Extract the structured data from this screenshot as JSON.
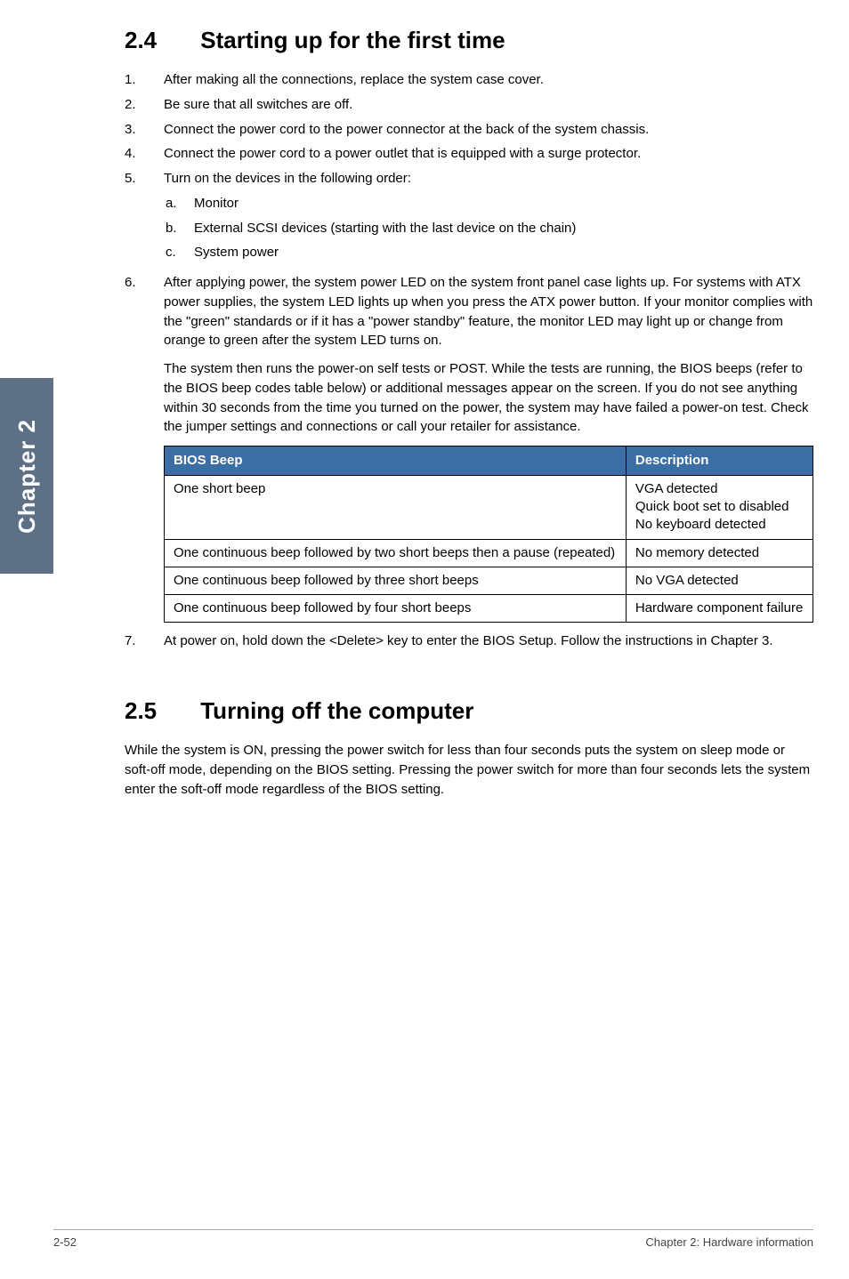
{
  "side_tab": "Chapter 2",
  "section_24": {
    "num": "2.4",
    "title": "Starting up for the first time",
    "steps": [
      {
        "n": "1.",
        "text": "After making all the connections, replace the system case cover."
      },
      {
        "n": "2.",
        "text": "Be sure that all switches are off."
      },
      {
        "n": "3.",
        "text": "Connect the power cord to the power connector at the back of the system chassis."
      },
      {
        "n": "4.",
        "text": "Connect the power cord to a power outlet that is equipped with a surge protector."
      },
      {
        "n": "5.",
        "text": "Turn on the devices in the following order:",
        "sub": [
          {
            "n": "a.",
            "text": "Monitor"
          },
          {
            "n": "b.",
            "text": "External SCSI devices (starting with the last device on the chain)"
          },
          {
            "n": "c.",
            "text": "System power"
          }
        ]
      },
      {
        "n": "6.",
        "text": "After applying power, the system power LED on the system front panel case lights up. For systems with ATX power supplies, the system LED lights up when you press the ATX power button. If your monitor complies with the \"green\" standards or if it has a \"power standby\" feature, the monitor LED may light up or change from orange to green after the system LED turns on.",
        "para2": "The system then runs the power-on self tests or POST. While the tests are running, the BIOS beeps (refer to the BIOS beep codes table below) or additional messages appear on the screen. If you do not see anything within 30 seconds from the time you turned on the power, the system may have failed a power-on test. Check the jumper settings and connections or call your retailer for assistance."
      }
    ],
    "table": {
      "headers": [
        "BIOS Beep",
        "Description"
      ],
      "rows": [
        {
          "beep": "One short beep",
          "desc": "VGA detected\nQuick boot set to disabled\nNo keyboard detected"
        },
        {
          "beep": "One continuous beep followed by two short beeps then a pause (repeated)",
          "desc": "No memory detected"
        },
        {
          "beep": "One continuous beep followed by three short beeps",
          "desc": "No VGA detected"
        },
        {
          "beep": "One continuous beep followed by four short beeps",
          "desc": "Hardware component failure"
        }
      ]
    },
    "step7": {
      "n": "7.",
      "text": "At power on, hold down the <Delete> key to enter the BIOS Setup. Follow the instructions in Chapter 3."
    }
  },
  "section_25": {
    "num": "2.5",
    "title": "Turning off the computer",
    "body": "While the system is ON, pressing the power switch for less than four seconds puts the system on sleep mode or soft-off mode, depending on the BIOS setting. Pressing the power switch for more than four seconds lets the system enter the soft-off mode regardless of the BIOS setting."
  },
  "footer": {
    "left": "2-52",
    "right": "Chapter 2: Hardware information"
  }
}
